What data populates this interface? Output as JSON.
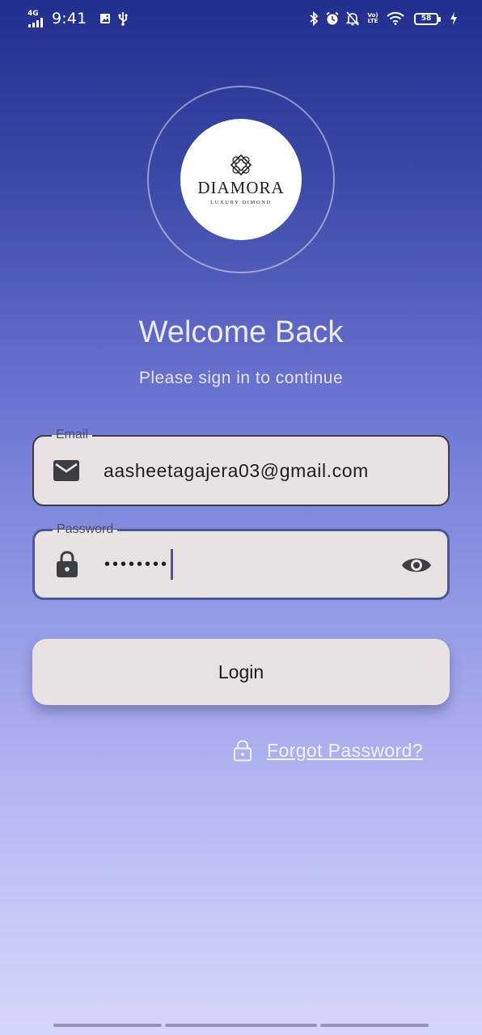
{
  "status_bar": {
    "network": "4G",
    "time": "9:41",
    "lte_label": "Vo) LTE",
    "battery": "58",
    "icons": [
      "signal-icon",
      "gallery-icon",
      "usb-icon",
      "bluetooth-icon",
      "alarm-icon",
      "mute-bell-icon",
      "wifi-icon",
      "charging-icon"
    ]
  },
  "logo": {
    "brand": "DIAMORA",
    "tagline": "LUXURY DIMOND"
  },
  "heading": {
    "title": "Welcome Back",
    "subtitle": "Please sign in to continue"
  },
  "email": {
    "label": "Email",
    "value": "aasheetagajera03@gmail.com",
    "icon": "mail-icon"
  },
  "password": {
    "label": "Password",
    "value": "••••••••",
    "icon": "lock-icon",
    "toggle_icon": "eye-icon"
  },
  "login": {
    "label": "Login"
  },
  "forgot": {
    "label": "Forgot Password?",
    "icon": "lock-outline-icon"
  },
  "colors": {
    "gradient_top": "#232f8e",
    "gradient_bottom": "#d6d6fb",
    "field_bg": "#e8e2e3",
    "focus_border": "#4e559a"
  }
}
